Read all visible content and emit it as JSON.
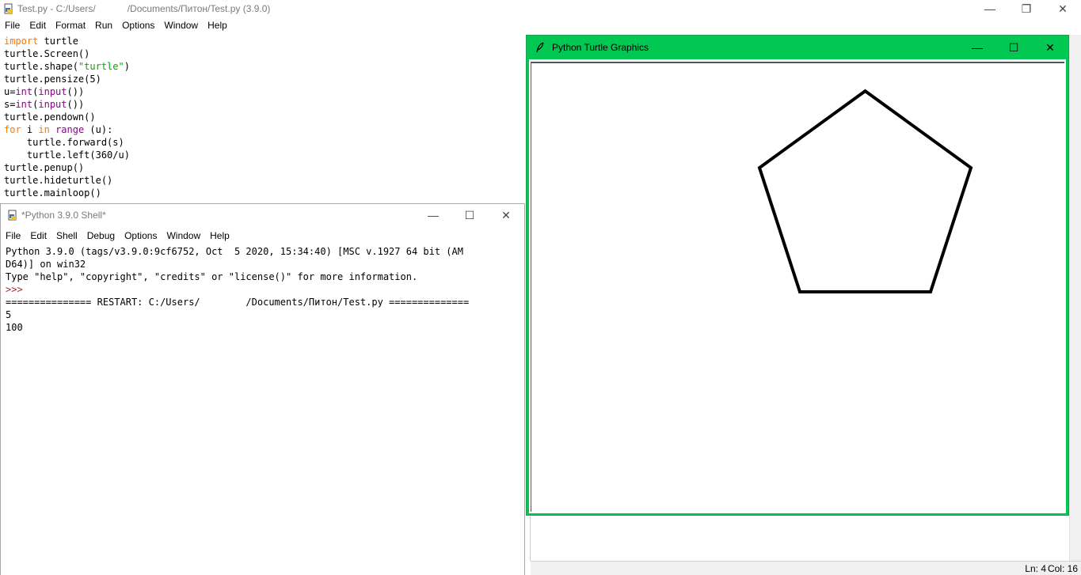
{
  "editor": {
    "title": "Test.py - C:/Users/            /Documents/Питон/Test.py (3.9.0)",
    "menu": [
      "File",
      "Edit",
      "Format",
      "Run",
      "Options",
      "Window",
      "Help"
    ],
    "code_lines": [
      [
        {
          "t": "import",
          "c": "kw"
        },
        {
          "t": " turtle"
        }
      ],
      [
        {
          "t": "turtle.Screen()"
        }
      ],
      [
        {
          "t": "turtle.shape("
        },
        {
          "t": "\"turtle\"",
          "c": "st"
        },
        {
          "t": ")"
        }
      ],
      [
        {
          "t": "turtle.pensize(5)"
        }
      ],
      [
        {
          "t": "u="
        },
        {
          "t": "int",
          "c": "bi"
        },
        {
          "t": "("
        },
        {
          "t": "input",
          "c": "bi"
        },
        {
          "t": "())"
        }
      ],
      [
        {
          "t": "s="
        },
        {
          "t": "int",
          "c": "bi"
        },
        {
          "t": "("
        },
        {
          "t": "input",
          "c": "bi"
        },
        {
          "t": "())"
        }
      ],
      [
        {
          "t": "turtle.pendown()"
        }
      ],
      [
        {
          "t": "for",
          "c": "kw"
        },
        {
          "t": " i "
        },
        {
          "t": "in",
          "c": "kw"
        },
        {
          "t": " "
        },
        {
          "t": "range",
          "c": "bi"
        },
        {
          "t": " (u):"
        }
      ],
      [
        {
          "t": "    turtle.forward(s)"
        }
      ],
      [
        {
          "t": "    turtle.left(360/u)"
        }
      ],
      [
        {
          "t": "turtle.penup()"
        }
      ],
      [
        {
          "t": "turtle.hideturtle()"
        }
      ],
      [
        {
          "t": "turtle.mainloop()"
        }
      ]
    ],
    "status": {
      "ln": "Ln: 4",
      "col": "Col: 16"
    }
  },
  "shell": {
    "title": "*Python 3.9.0 Shell*",
    "menu": [
      "File",
      "Edit",
      "Shell",
      "Debug",
      "Options",
      "Window",
      "Help"
    ],
    "lines": [
      {
        "t": "Python 3.9.0 (tags/v3.9.0:9cf6752, Oct  5 2020, 15:34:40) [MSC v.1927 64 bit (AM",
        "c": "shell-out"
      },
      {
        "t": "D64)] on win32",
        "c": "shell-out"
      },
      {
        "t": "Type \"help\", \"copyright\", \"credits\" or \"license()\" for more information.",
        "c": "shell-out"
      },
      {
        "t": ">>> ",
        "c": "prompt"
      },
      {
        "t": "=============== RESTART: C:/Users/        /Documents/Питон/Test.py ==============",
        "c": "shell-out"
      },
      {
        "t": "5",
        "c": "shell-out"
      },
      {
        "t": "100",
        "c": "shell-out"
      }
    ]
  },
  "turtle": {
    "title": "Python Turtle Graphics",
    "drawing": {
      "shape": "pentagon",
      "sides": 5,
      "side_length": 100,
      "pensize": 5
    }
  },
  "colors": {
    "turtle_titlebar": "#00c853",
    "keyword": "#ff7700",
    "builtin": "#900090",
    "string": "#00aa00",
    "prompt": "#a52a2a"
  }
}
